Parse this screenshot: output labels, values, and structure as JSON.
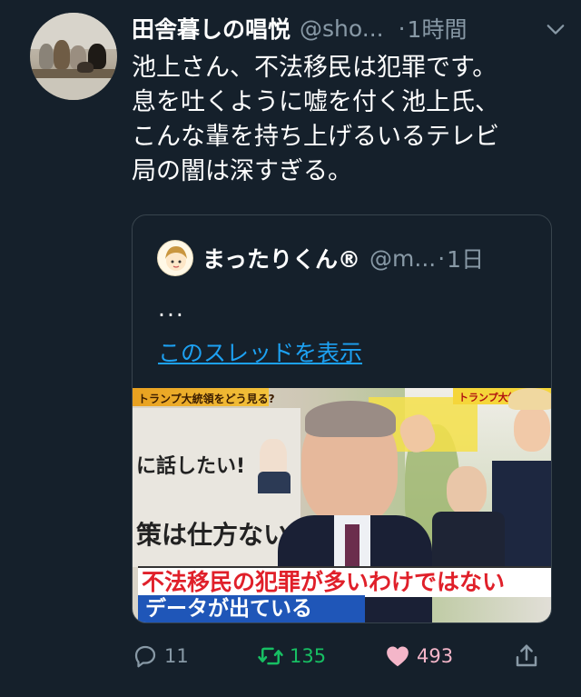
{
  "tweet": {
    "display_name": "田舎暮しの唱悦",
    "handle": "@sho...",
    "separator": "·",
    "time": "1時間",
    "lines": [
      "池上さん、不法移民は犯罪です。",
      "息を吐くように嘘を付く池上氏、",
      "こんな輩を持ち上げるいるテレビ",
      "局の闇は深すぎる。"
    ]
  },
  "quoted": {
    "display_name": "まったりくん®",
    "handle": "@m...",
    "separator": "·",
    "time": "1日",
    "ellipsis": "...",
    "thread_link": "このスレッドを表示",
    "image": {
      "banner_left": "トランプ大統領をどう見る?",
      "banner_right": "トランプ大統領!?",
      "board_line1": "に話したい!",
      "board_line2": "策は仕方ない",
      "caption_line1": "不法移民の犯罪が多いわけではない",
      "caption_line2": "データが出ている"
    }
  },
  "actions": {
    "reply_count": "11",
    "retweet_count": "135",
    "like_count": "493"
  },
  "colors": {
    "background": "#15202b",
    "secondary_text": "#8899a6",
    "link": "#1da1f2",
    "retweet": "#17bf63",
    "like": "#f4b6c9",
    "border": "#38444d"
  }
}
